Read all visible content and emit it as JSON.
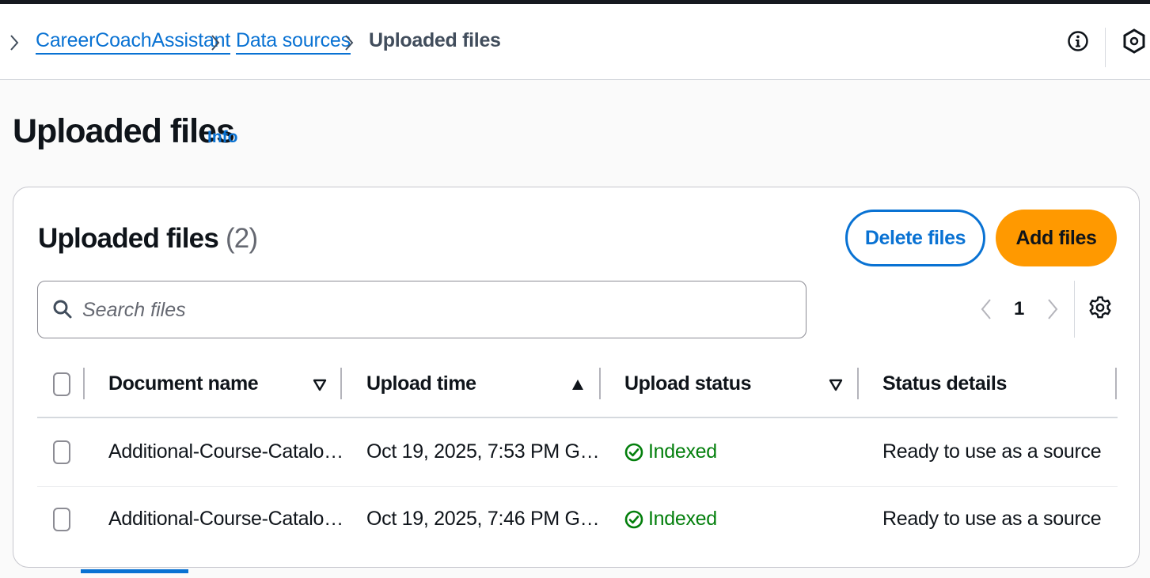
{
  "breadcrumb": {
    "items": [
      {
        "label": "CareerCoachAssistant"
      },
      {
        "label": "Data sources"
      },
      {
        "label": "Uploaded files"
      }
    ]
  },
  "tools": {
    "info_icon": "info-circle-icon",
    "help_icon": "hexagon-icon"
  },
  "page": {
    "title": "Uploaded files",
    "info_link": "Info"
  },
  "container": {
    "title": "Uploaded files",
    "count": "(2)",
    "delete_label": "Delete files",
    "add_label": "Add files"
  },
  "search": {
    "placeholder": "Search files",
    "value": ""
  },
  "pagination": {
    "current_page": "1"
  },
  "table": {
    "columns": [
      {
        "label": "Document name",
        "sort": "▼"
      },
      {
        "label": "Upload time",
        "sort": "▲"
      },
      {
        "label": "Upload status",
        "sort": "▼"
      },
      {
        "label": "Status details",
        "sort": ""
      }
    ],
    "rows": [
      {
        "name": "Additional-Course-Catalo…",
        "time": "Oct 19, 2025, 7:53 PM G…",
        "status": "Indexed",
        "details": "Ready to use as a source"
      },
      {
        "name": "Additional-Course-Catalo…",
        "time": "Oct 19, 2025, 7:46 PM G…",
        "status": "Indexed",
        "details": "Ready to use as a source"
      }
    ]
  },
  "colors": {
    "link": "#0972d3",
    "primary_button": "#ff9900",
    "success": "#037f0c",
    "text": "#0f141a"
  }
}
